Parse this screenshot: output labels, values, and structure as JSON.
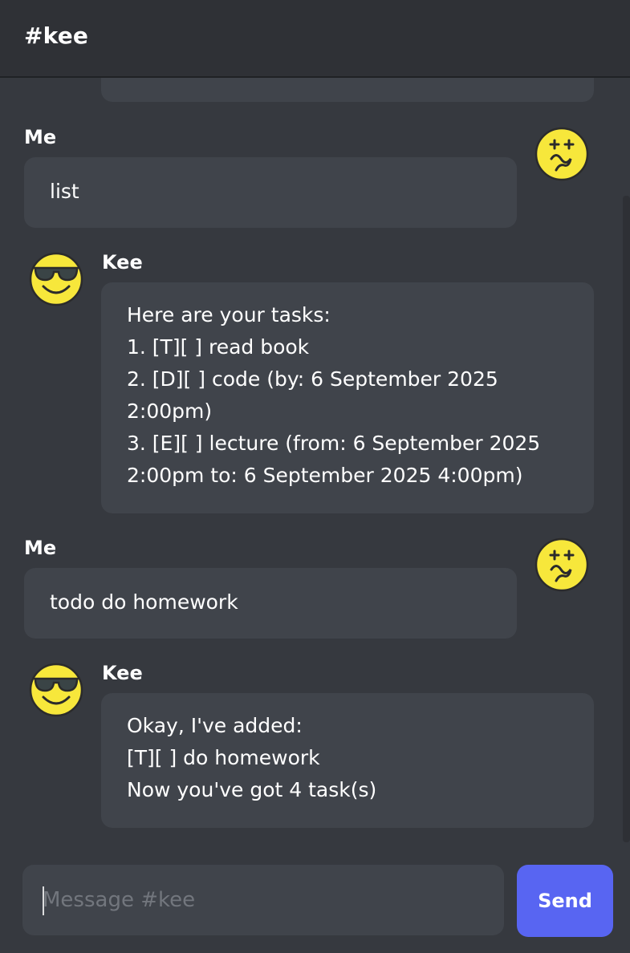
{
  "header": {
    "title": "#kee"
  },
  "messages": [
    {
      "sender": "Me",
      "lines": [
        "list"
      ]
    },
    {
      "sender": "Kee",
      "lines": [
        "Here are your tasks:",
        "1. [T][ ] read book",
        "2. [D][ ] code (by: 6 September 2025",
        "2:00pm)",
        "3. [E][ ] lecture (from: 6 September 2025",
        "2:00pm to: 6 September 2025 4:00pm)"
      ]
    },
    {
      "sender": "Me",
      "lines": [
        "todo do homework"
      ]
    },
    {
      "sender": "Kee",
      "lines": [
        "Okay, I've added:",
        "[T][ ] do homework",
        "Now you've got 4 task(s)"
      ]
    }
  ],
  "composer": {
    "placeholder": "Message #kee",
    "value": "",
    "send_label": "Send"
  },
  "icons": {
    "user_avatar": "dizzy-face-icon",
    "bot_avatar": "sunglasses-face-icon"
  },
  "colors": {
    "background": "#36393f",
    "header": "#2f3136",
    "bubble": "#40444b",
    "accent": "#5865f2",
    "emoji": "#f7e73b"
  }
}
